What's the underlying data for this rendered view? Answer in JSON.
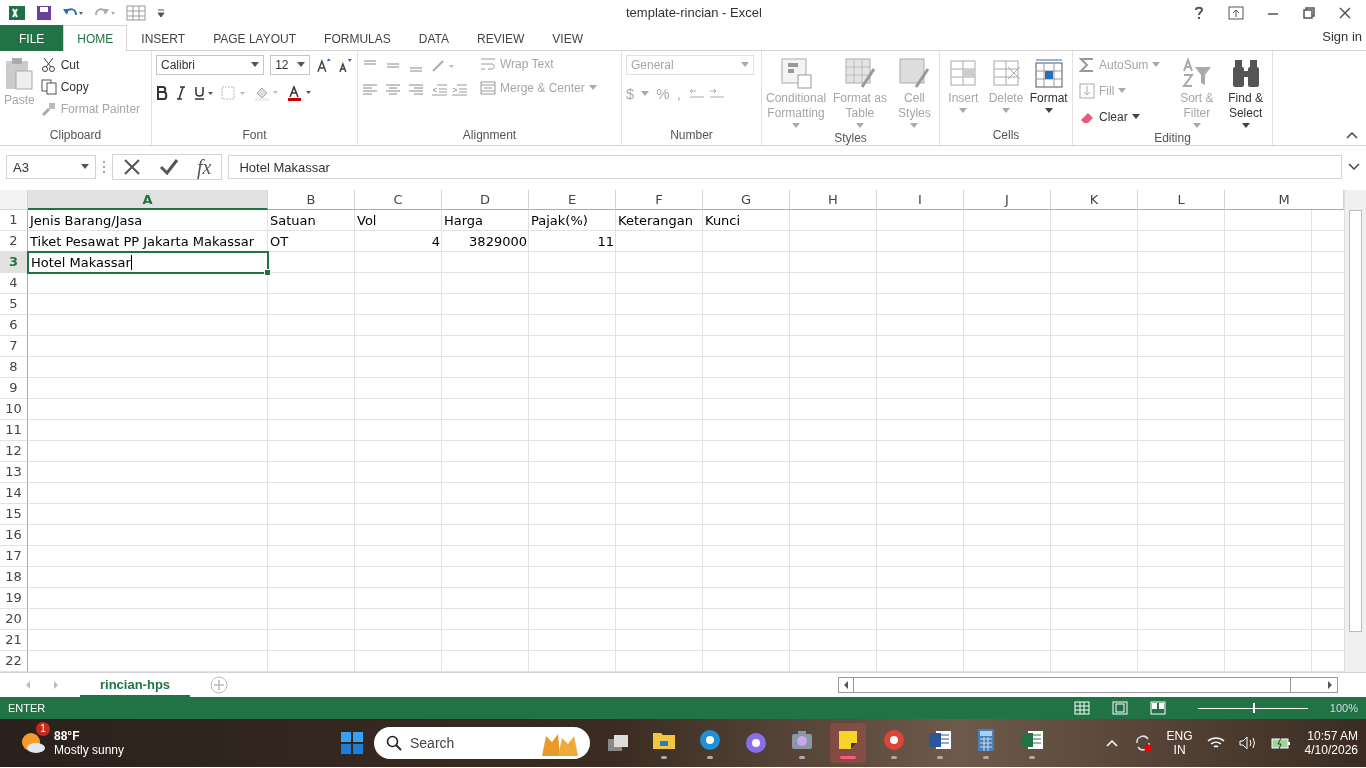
{
  "window": {
    "title": "template-rincian - Excel",
    "sign_in": "Sign in"
  },
  "tabs": [
    {
      "label": "FILE",
      "kind": "file",
      "selected": false
    },
    {
      "label": "HOME",
      "kind": "tab",
      "selected": true
    },
    {
      "label": "INSERT",
      "kind": "tab",
      "selected": false
    },
    {
      "label": "PAGE LAYOUT",
      "kind": "tab",
      "selected": false
    },
    {
      "label": "FORMULAS",
      "kind": "tab",
      "selected": false
    },
    {
      "label": "DATA",
      "kind": "tab",
      "selected": false
    },
    {
      "label": "REVIEW",
      "kind": "tab",
      "selected": false
    },
    {
      "label": "VIEW",
      "kind": "tab",
      "selected": false
    }
  ],
  "clipboard": {
    "label": "Clipboard",
    "paste": {
      "label": "Paste",
      "disabled": true
    },
    "items": [
      {
        "label": "Cut",
        "kind": "cut",
        "disabled": false
      },
      {
        "label": "Copy",
        "kind": "copy",
        "disabled": false
      },
      {
        "label": "Format Painter",
        "kind": "painter",
        "disabled": true
      }
    ]
  },
  "font": {
    "label": "Font",
    "name": "Calibri",
    "size": "12"
  },
  "alignment": {
    "label": "Alignment",
    "wrap": {
      "label": "Wrap Text",
      "disabled": true
    },
    "merge": {
      "label": "Merge & Center",
      "disabled": true
    }
  },
  "number": {
    "label": "Number",
    "format": "General",
    "currency": "$",
    "percent": "%",
    "comma": ","
  },
  "styles": {
    "label": "Styles",
    "items": [
      {
        "label": "Conditional Formatting",
        "kind": "conditional",
        "disabled": true
      },
      {
        "label": "Format as Table",
        "kind": "table",
        "disabled": true
      },
      {
        "label": "Cell Styles",
        "kind": "styles",
        "disabled": true
      }
    ]
  },
  "cells": {
    "label": "Cells",
    "items": [
      {
        "label": "Insert",
        "kind": "insert",
        "disabled": true
      },
      {
        "label": "Delete",
        "kind": "delete",
        "disabled": true
      },
      {
        "label": "Format",
        "kind": "format",
        "disabled": false
      }
    ]
  },
  "editing": {
    "label": "Editing",
    "small": [
      {
        "label": "AutoSum",
        "kind": "sum",
        "disabled": true
      },
      {
        "label": "Fill",
        "kind": "fill",
        "disabled": true
      },
      {
        "label": "Clear",
        "kind": "clear",
        "disabled": false
      }
    ],
    "big": [
      {
        "label": "Sort & Filter",
        "kind": "sort",
        "disabled": true
      },
      {
        "label": "Find & Select",
        "kind": "find",
        "disabled": false
      }
    ]
  },
  "formula_bar": {
    "name_box": "A3",
    "fx": "fx",
    "value": "Hotel Makassar"
  },
  "columns": [
    {
      "label": "A",
      "selected": true
    },
    {
      "label": "B",
      "selected": false
    },
    {
      "label": "C",
      "selected": false
    },
    {
      "label": "D",
      "selected": false
    },
    {
      "label": "E",
      "selected": false
    },
    {
      "label": "F",
      "selected": false
    },
    {
      "label": "G",
      "selected": false
    },
    {
      "label": "H",
      "selected": false
    },
    {
      "label": "I",
      "selected": false
    },
    {
      "label": "J",
      "selected": false
    },
    {
      "label": "K",
      "selected": false
    },
    {
      "label": "L",
      "selected": false
    },
    {
      "label": "M",
      "selected": false
    }
  ],
  "rows": [
    {
      "number": "1",
      "selected": false,
      "cells": [
        {
          "text": "Jenis Barang/Jasa",
          "kind": "text"
        },
        {
          "text": "Satuan",
          "kind": "text"
        },
        {
          "text": "Vol",
          "kind": "text"
        },
        {
          "text": "Harga",
          "kind": "text"
        },
        {
          "text": "Pajak(%)",
          "kind": "text"
        },
        {
          "text": "Keterangan",
          "kind": "text"
        },
        {
          "text": "Kunci",
          "kind": "text"
        }
      ]
    },
    {
      "number": "2",
      "selected": false,
      "cells": [
        {
          "text": "Tiket Pesawat PP Jakarta Makassar",
          "kind": "text"
        },
        {
          "text": "OT",
          "kind": "text"
        },
        {
          "text": "4",
          "kind": "number"
        },
        {
          "text": "3829000",
          "kind": "number"
        },
        {
          "text": "11",
          "kind": "number"
        }
      ]
    },
    {
      "number": "3",
      "selected": true,
      "cells": [
        {
          "text": "Hotel Makassar",
          "kind": "editing"
        }
      ]
    },
    {
      "number": "4",
      "selected": false,
      "cells": []
    },
    {
      "number": "5",
      "selected": false,
      "cells": []
    },
    {
      "number": "6",
      "selected": false,
      "cells": []
    },
    {
      "number": "7",
      "selected": false,
      "cells": []
    },
    {
      "number": "8",
      "selected": false,
      "cells": []
    },
    {
      "number": "9",
      "selected": false,
      "cells": []
    },
    {
      "number": "10",
      "selected": false,
      "cells": []
    },
    {
      "number": "11",
      "selected": false,
      "cells": []
    },
    {
      "number": "12",
      "selected": false,
      "cells": []
    },
    {
      "number": "13",
      "selected": false,
      "cells": []
    },
    {
      "number": "14",
      "selected": false,
      "cells": []
    },
    {
      "number": "15",
      "selected": false,
      "cells": []
    },
    {
      "number": "16",
      "selected": false,
      "cells": []
    },
    {
      "number": "17",
      "selected": false,
      "cells": []
    },
    {
      "number": "18",
      "selected": false,
      "cells": []
    },
    {
      "number": "19",
      "selected": false,
      "cells": []
    },
    {
      "number": "20",
      "selected": false,
      "cells": []
    },
    {
      "number": "21",
      "selected": false,
      "cells": []
    },
    {
      "number": "22",
      "selected": false,
      "cells": []
    }
  ],
  "sheet_tabs": [
    {
      "label": "rincian-hps",
      "selected": true
    }
  ],
  "status_bar": {
    "mode": "ENTER",
    "zoom": "100%",
    "zoom_slider": {
      "level": 0.5
    }
  },
  "taskbar": {
    "weather": {
      "badge": "1",
      "temperature": "88°F",
      "condition": "Mostly sunny"
    },
    "search": {
      "placeholder": "Search"
    },
    "apps": [
      {
        "kind": "taskview",
        "active": false,
        "open": false
      },
      {
        "kind": "explorer",
        "active": false,
        "open": true
      },
      {
        "kind": "edge",
        "active": false,
        "open": true
      },
      {
        "kind": "copilot",
        "active": false,
        "open": false
      },
      {
        "kind": "camera",
        "active": false,
        "open": true
      },
      {
        "kind": "notes",
        "active": true,
        "open": true
      },
      {
        "kind": "chrome",
        "active": false,
        "open": true
      },
      {
        "kind": "word",
        "active": false,
        "open": true
      },
      {
        "kind": "calculator",
        "active": false,
        "open": true
      },
      {
        "kind": "excel",
        "active": false,
        "open": true
      }
    ],
    "language": {
      "line_1": "ENG",
      "line_2": "IN"
    },
    "time": "10:57 AM",
    "date": "4/10/2026"
  }
}
